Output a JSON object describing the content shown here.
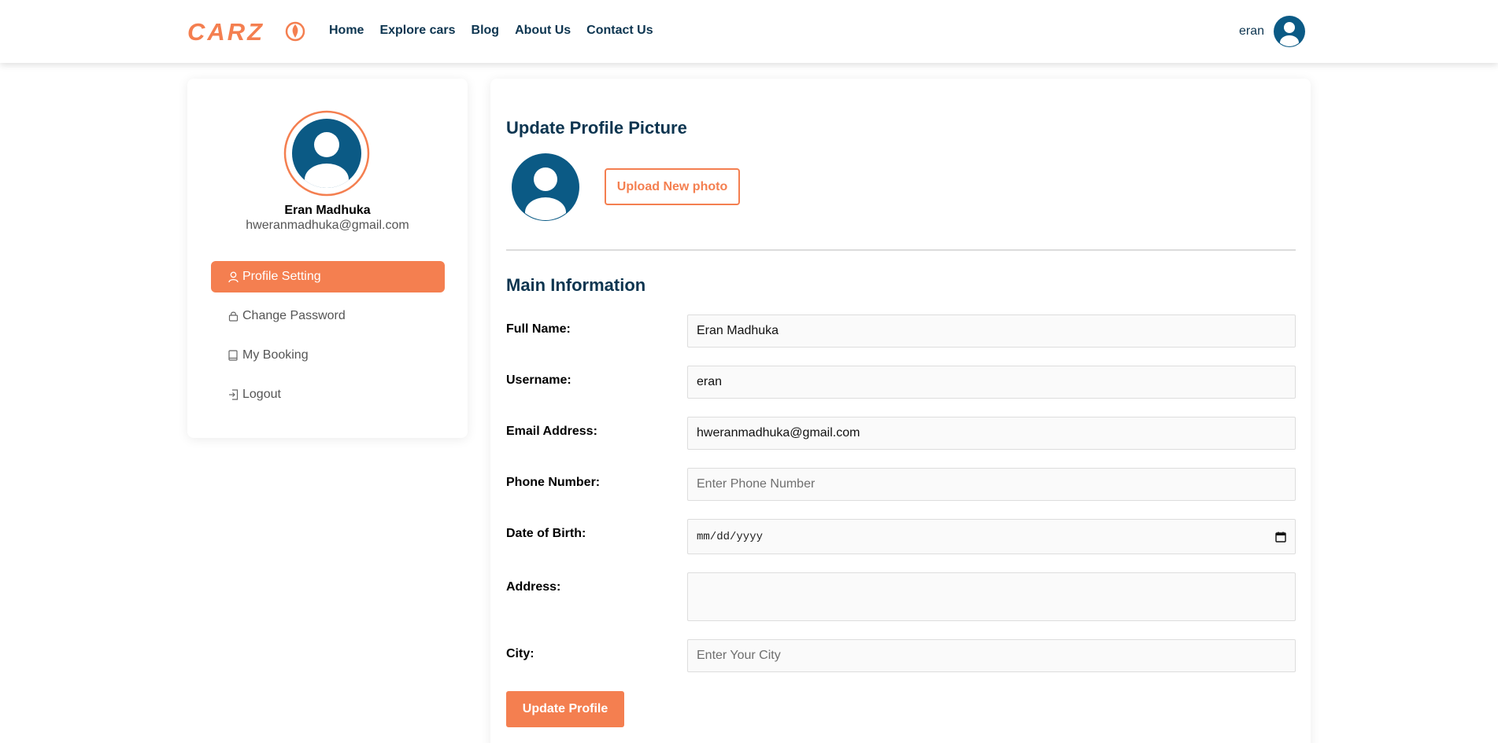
{
  "header": {
    "logo_text": "CARZ",
    "nav": [
      "Home",
      "Explore cars",
      "Blog",
      "About Us",
      "Contact Us"
    ],
    "user_name": "eran"
  },
  "sidebar": {
    "name": "Eran Madhuka",
    "email": "hweranmadhuka@gmail.com",
    "menu": [
      {
        "label": "Profile Setting",
        "icon": "user-icon",
        "active": true
      },
      {
        "label": "Change Password",
        "icon": "lock-icon",
        "active": false
      },
      {
        "label": "My Booking",
        "icon": "book-icon",
        "active": false
      },
      {
        "label": "Logout",
        "icon": "logout-icon",
        "active": false
      }
    ]
  },
  "main": {
    "picture_title": "Update Profile Picture",
    "upload_label": "Upload New photo",
    "info_title": "Main Information",
    "fields": {
      "full_name": {
        "label": "Full Name:",
        "value": "Eran Madhuka"
      },
      "username": {
        "label": "Username:",
        "value": "eran"
      },
      "email": {
        "label": "Email Address:",
        "value": "hweranmadhuka@gmail.com"
      },
      "phone": {
        "label": "Phone Number:",
        "placeholder": "Enter Phone Number"
      },
      "dob": {
        "label": "Date of Birth:",
        "placeholder": "mm/dd/yyyy"
      },
      "address": {
        "label": "Address:",
        "value": ""
      },
      "city": {
        "label": "City:",
        "placeholder": "Enter Your City"
      }
    },
    "update_label": "Update Profile"
  },
  "colors": {
    "accent": "#f47f50",
    "navy": "#0d3550",
    "avatar": "#0b5a85"
  }
}
